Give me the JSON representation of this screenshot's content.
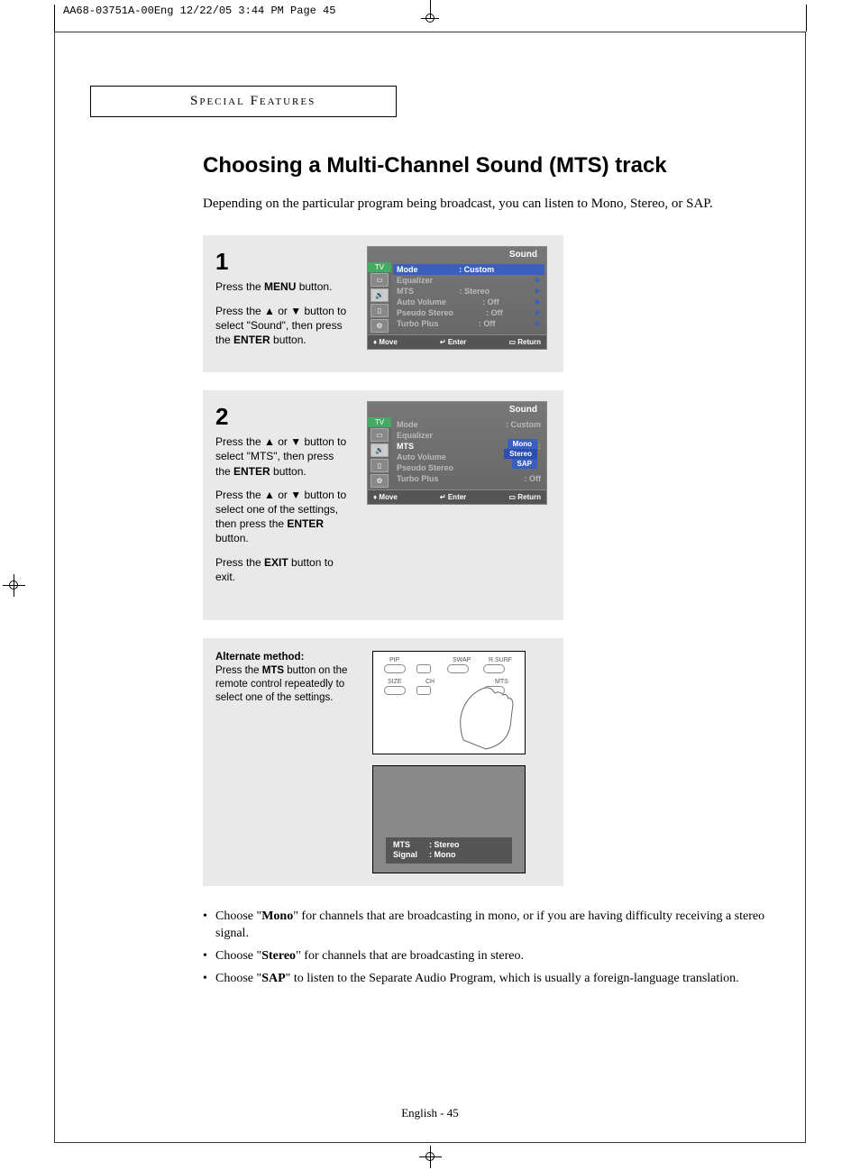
{
  "slug": "AA68-03751A-00Eng  12/22/05  3:44 PM  Page 45",
  "section_header": "Special Features",
  "title": "Choosing a Multi-Channel Sound (MTS) track",
  "intro": "Depending on the particular program being broadcast, you can listen to Mono, Stereo, or SAP.",
  "step1": {
    "num": "1",
    "p1a": "Press the ",
    "p1b": "MENU",
    "p1c": " button.",
    "p2a": "Press the ▲ or ▼ button to select \"Sound\", then press the ",
    "p2b": "ENTER",
    "p2c": " button."
  },
  "step2": {
    "num": "2",
    "p1a": "Press the ▲ or ▼ button to select \"MTS\", then press the ",
    "p1b": "ENTER",
    "p1c": " button.",
    "p2a": "Press the ▲ or ▼ button to select one of the settings, then press the ",
    "p2b": "ENTER",
    "p2c": " button.",
    "p3a": "Press the ",
    "p3b": "EXIT",
    "p3c": " button to exit."
  },
  "osd_title": "Sound",
  "osd_side_tv": "TV",
  "osd1": {
    "rows": [
      {
        "label": "Mode",
        "value": ":  Custom",
        "hl": true
      },
      {
        "label": "Equalizer",
        "value": ""
      },
      {
        "label": "MTS",
        "value": ":  Stereo"
      },
      {
        "label": "Auto Volume",
        "value": ":  Off"
      },
      {
        "label": "Pseudo Stereo",
        "value": ":  Off"
      },
      {
        "label": "Turbo Plus",
        "value": ":  Off"
      }
    ]
  },
  "osd2": {
    "rows": [
      {
        "label": "Mode",
        "value": ":  Custom"
      },
      {
        "label": "Equalizer",
        "value": ""
      },
      {
        "label": "MTS",
        "value": ":",
        "hl": true
      },
      {
        "label": "Auto Volume",
        "value": ""
      },
      {
        "label": "Pseudo Stereo",
        "value": ""
      },
      {
        "label": "Turbo Plus",
        "value": ":  Off"
      }
    ],
    "popup": [
      "Mono",
      "Stereo",
      "SAP"
    ]
  },
  "osd_foot": {
    "move": "Move",
    "enter": "Enter",
    "return": "Return"
  },
  "alt": {
    "heading": "Alternate method:",
    "text_a": "Press the ",
    "text_b": "MTS",
    "text_c": " button on the remote control repeatedly to select one of the settings."
  },
  "remote_labels": {
    "pip": "PIP",
    "swap": "SWAP",
    "rsurf": "R.SURF",
    "size": "SIZE",
    "ch": "CH",
    "mts": "MTS"
  },
  "tv_overlay": {
    "l1a": "MTS",
    "l1b": ":  Stereo",
    "l2a": "Signal",
    "l2b": ":  Mono"
  },
  "bullets": [
    {
      "pre": "Choose \"",
      "b": "Mono",
      "post": "\" for channels that are broadcasting in mono, or if you are having difficulty receiving a stereo signal."
    },
    {
      "pre": "Choose \"",
      "b": "Stereo",
      "post": "\" for channels that are broadcasting in stereo."
    },
    {
      "pre": "Choose \"",
      "b": "SAP",
      "post": "\" to listen to the Separate Audio Program, which is usually a foreign-language translation."
    }
  ],
  "page_num": "English - 45"
}
